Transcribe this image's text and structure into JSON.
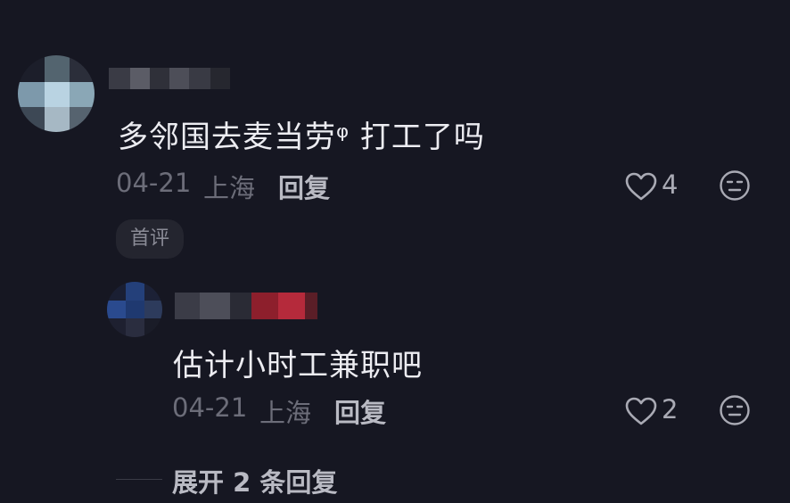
{
  "comments": [
    {
      "text": "多邻国去麦当劳ᵠ 打工了吗",
      "date": "04-21",
      "location": "上海",
      "reply_label": "回复",
      "likes": "4",
      "badge": "首评",
      "like_icon": "heart-icon",
      "reaction_icon": "neutral-face-icon"
    },
    {
      "text": "估计小时工兼职吧",
      "date": "04-21",
      "location": "上海",
      "reply_label": "回复",
      "likes": "2",
      "like_icon": "heart-icon",
      "reaction_icon": "neutral-face-icon"
    }
  ],
  "expand_replies": "展开 2 条回复",
  "colors": {
    "background": "#161722",
    "text": "#ececf1",
    "meta": "#6c6d79"
  }
}
